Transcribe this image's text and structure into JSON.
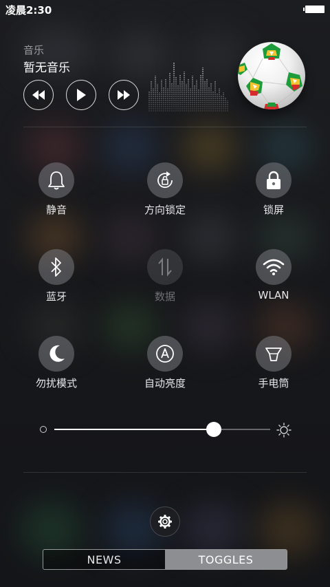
{
  "status_bar": {
    "time": "凌晨2:30"
  },
  "music": {
    "label": "音乐",
    "track": "暂无音乐",
    "controls": [
      "rewind-icon",
      "play-icon",
      "fast-forward-icon"
    ]
  },
  "toggles": [
    {
      "label": "静音",
      "icon": "bell-icon",
      "enabled": true
    },
    {
      "label": "方向锁定",
      "icon": "rotation-lock-icon",
      "enabled": true
    },
    {
      "label": "锁屏",
      "icon": "lock-icon",
      "enabled": true
    },
    {
      "label": "蓝牙",
      "icon": "bluetooth-icon",
      "enabled": true
    },
    {
      "label": "数据",
      "icon": "data-arrows-icon",
      "enabled": false
    },
    {
      "label": "WLAN",
      "icon": "wifi-icon",
      "enabled": true
    },
    {
      "label": "勿扰模式",
      "icon": "moon-icon",
      "enabled": true
    },
    {
      "label": "自动亮度",
      "icon": "auto-brightness-icon",
      "enabled": true
    },
    {
      "label": "手电筒",
      "icon": "flashlight-icon",
      "enabled": true
    }
  ],
  "brightness": {
    "level": 0.74
  },
  "tabs": {
    "news": "NEWS",
    "toggles": "TOGGLES",
    "active": "toggles"
  }
}
